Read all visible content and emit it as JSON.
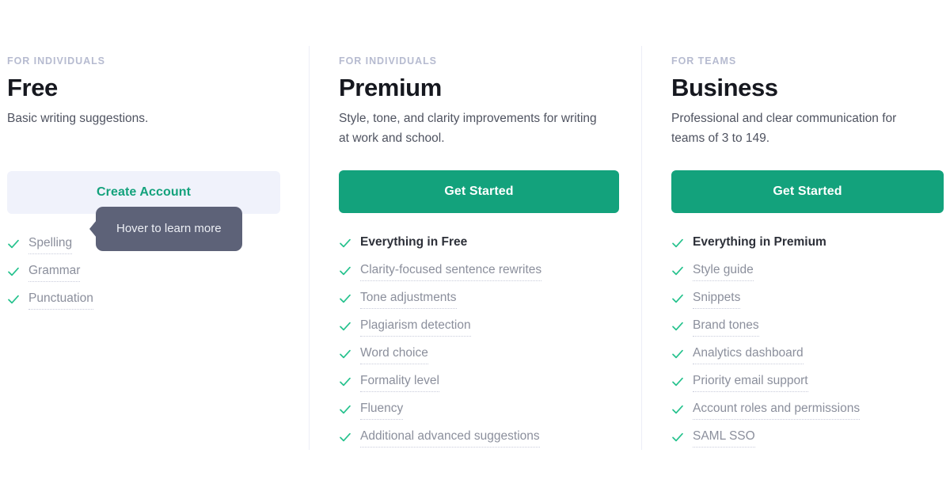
{
  "colors": {
    "accent_green": "#13a27c",
    "secondary_button_bg": "#f0f2fb",
    "tooltip_bg": "#5d6278",
    "divider": "#eceef7",
    "eyebrow_text": "#b6bbd0",
    "feature_text": "#8b8f9c",
    "heading_text": "#16181f"
  },
  "tooltip": {
    "text": "Hover to learn more",
    "anchor_feature": "Spelling"
  },
  "plans": [
    {
      "eyebrow": "FOR INDIVIDUALS",
      "name": "Free",
      "description": "Basic writing suggestions.",
      "cta_label": "Create Account",
      "cta_style": "secondary",
      "features": [
        {
          "label": "Spelling",
          "heading": false
        },
        {
          "label": "Grammar",
          "heading": false
        },
        {
          "label": "Punctuation",
          "heading": false
        }
      ]
    },
    {
      "eyebrow": "FOR INDIVIDUALS",
      "name": "Premium",
      "description": "Style, tone, and clarity improvements for writing at work and school.",
      "cta_label": "Get Started",
      "cta_style": "primary",
      "features": [
        {
          "label": "Everything in Free",
          "heading": true
        },
        {
          "label": "Clarity-focused sentence rewrites",
          "heading": false
        },
        {
          "label": "Tone adjustments",
          "heading": false
        },
        {
          "label": "Plagiarism detection",
          "heading": false
        },
        {
          "label": "Word choice",
          "heading": false
        },
        {
          "label": "Formality level",
          "heading": false
        },
        {
          "label": "Fluency",
          "heading": false
        },
        {
          "label": "Additional advanced suggestions",
          "heading": false
        }
      ]
    },
    {
      "eyebrow": "FOR TEAMS",
      "name": "Business",
      "description": "Professional and clear communication for teams of 3 to 149.",
      "cta_label": "Get Started",
      "cta_style": "primary",
      "features": [
        {
          "label": "Everything in Premium",
          "heading": true
        },
        {
          "label": "Style guide",
          "heading": false
        },
        {
          "label": "Snippets",
          "heading": false
        },
        {
          "label": "Brand tones",
          "heading": false
        },
        {
          "label": "Analytics dashboard",
          "heading": false
        },
        {
          "label": "Priority email support",
          "heading": false
        },
        {
          "label": "Account roles and permissions",
          "heading": false
        },
        {
          "label": "SAML SSO",
          "heading": false
        }
      ]
    }
  ]
}
